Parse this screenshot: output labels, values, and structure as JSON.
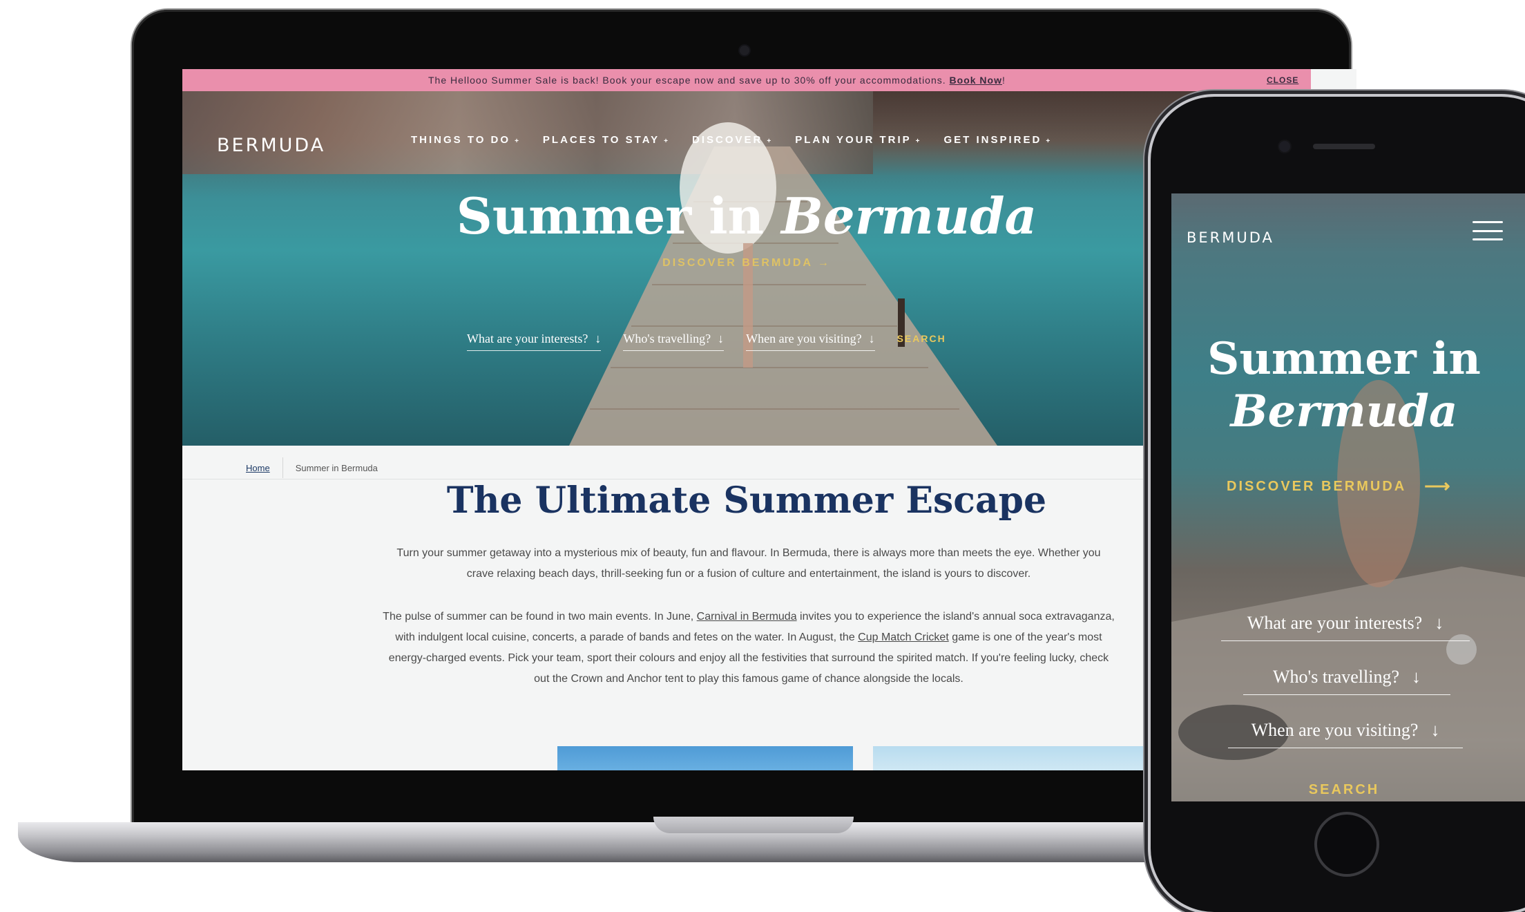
{
  "laptop": {
    "promo": {
      "text": "The Hellooo Summer Sale is back! Book your escape now and save up to 30% off your accommodations.",
      "link": "Book Now",
      "suffix": "!",
      "close": "CLOSE"
    },
    "logo": "BERMUDA",
    "nav": [
      {
        "label": "THINGS TO DO",
        "caret": "+"
      },
      {
        "label": "PLACES TO STAY",
        "caret": "+"
      },
      {
        "label": "DISCOVER",
        "caret": "+"
      },
      {
        "label": "PLAN YOUR TRIP",
        "caret": "+"
      },
      {
        "label": "GET INSPIRED",
        "caret": "+"
      }
    ],
    "hero": {
      "title_plain": "Summer in ",
      "title_em": "Bermuda",
      "discover": "DISCOVER BERMUDA",
      "discover_arrow": "→"
    },
    "filters": [
      {
        "label": "What are your interests?",
        "arrow": "↓"
      },
      {
        "label": "Who's travelling?",
        "arrow": "↓"
      },
      {
        "label": "When are you visiting?",
        "arrow": "↓"
      }
    ],
    "search": "SEARCH",
    "breadcrumb": {
      "home": "Home",
      "current": "Summer in Bermuda"
    },
    "section_title": "The Ultimate Summer Escape",
    "para1": "Turn your summer getaway into a mysterious mix of beauty, fun and flavour. In Bermuda, there is always more than meets the eye. Whether you crave relaxing beach days, thrill-seeking fun or a fusion of culture and entertainment, the island is yours to discover.",
    "para2": {
      "a": "The pulse of summer can be found in two main events. In June, ",
      "link1": "Carnival in Bermuda",
      "b": " invites you to experience the island's annual soca extravaganza, with indulgent local cuisine, concerts, a parade of bands and fetes on the water. In August, the ",
      "link2": "Cup Match Cricket",
      "c": " game is one of the year's most energy-charged events. Pick your team, sport their colours and enjoy all the festivities that surround the spirited match. If you're feeling lucky, check out the Crown and Anchor tent to play this famous game of chance alongside the locals."
    }
  },
  "phone": {
    "logo": "BERMUDA",
    "menu_icon": "hamburger-icon",
    "title_plain": "Summer in",
    "title_em": "Bermuda",
    "discover": "DISCOVER BERMUDA",
    "discover_arrow": "⟶",
    "filters": [
      {
        "label": "What are your interests?",
        "arrow": "↓"
      },
      {
        "label": "Who's travelling?",
        "arrow": "↓"
      },
      {
        "label": "When are you visiting?",
        "arrow": "↓"
      }
    ],
    "search": "SEARCH"
  },
  "colors": {
    "promo_bg": "#ea8fac",
    "accent_gold": "#e9c85d",
    "heading_navy": "#1a3361"
  }
}
